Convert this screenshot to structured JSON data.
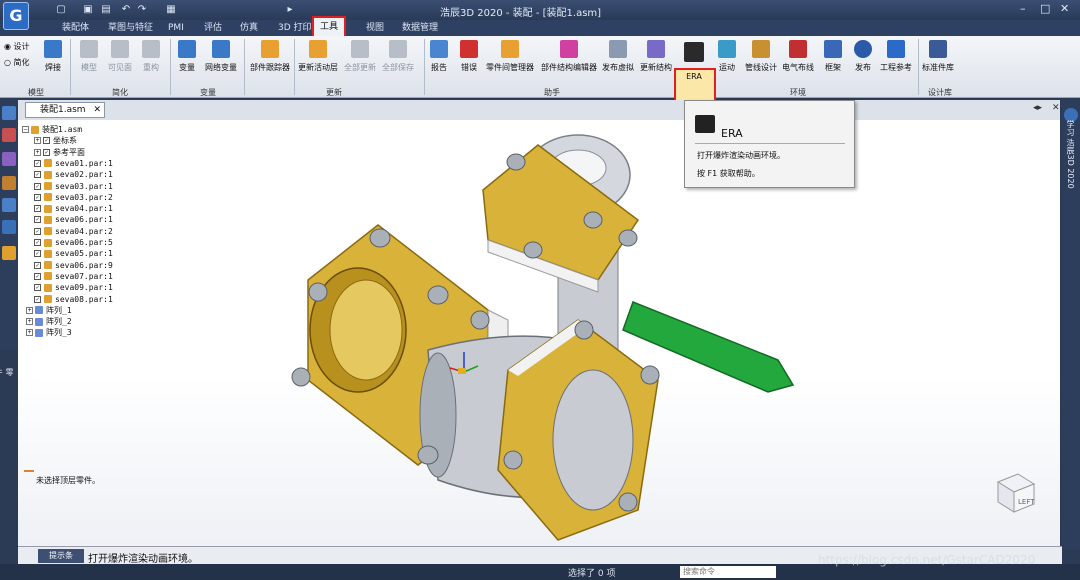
{
  "app": {
    "title": "浩辰3D 2020 - 装配 - [装配1.asm]"
  },
  "quick_access": [
    "new-icon",
    "open-icon",
    "save-icon",
    "undo-icon",
    "redo-icon",
    "print-icon",
    "dropdown-icon"
  ],
  "tabs": [
    "装配体",
    "草图与特征",
    "PMI",
    "评估",
    "仿真",
    "3D 打印",
    "工具",
    "视图",
    "数据管理"
  ],
  "active_tab": "工具",
  "ribbon": {
    "mode_options": [
      "设计",
      "简化"
    ],
    "buttons": [
      {
        "label": "焊接",
        "icon": "weld-icon"
      },
      {
        "label": "模型",
        "icon": "model-icon",
        "disabled": true
      },
      {
        "label": "可见面",
        "icon": "visible-face-icon",
        "disabled": true
      },
      {
        "label": "重构",
        "icon": "rebuild-icon",
        "disabled": true
      },
      {
        "label": "变量",
        "icon": "variable-icon"
      },
      {
        "label": "网络变量",
        "icon": "network-variable-icon"
      },
      {
        "label": "部件跟踪器",
        "icon": "tracker-icon"
      },
      {
        "label": "更新活动层",
        "icon": "update-layer-icon"
      },
      {
        "label": "全部更新",
        "icon": "update-all-icon",
        "disabled": true
      },
      {
        "label": "全部保存",
        "icon": "save-all-icon",
        "disabled": true
      },
      {
        "label": "报告",
        "icon": "report-icon"
      },
      {
        "label": "错误",
        "icon": "error-icon"
      },
      {
        "label": "零件间管理器",
        "icon": "interpart-icon"
      },
      {
        "label": "部件结构编辑器",
        "icon": "structure-editor-icon"
      },
      {
        "label": "发布虚拟",
        "icon": "publish-virtual-icon"
      },
      {
        "label": "更新结构",
        "icon": "update-structure-icon"
      },
      {
        "label": "ERA",
        "icon": "era-icon"
      },
      {
        "label": "运动",
        "icon": "motion-icon"
      },
      {
        "label": "管线设计",
        "icon": "piping-icon"
      },
      {
        "label": "电气布线",
        "icon": "wiring-icon"
      },
      {
        "label": "框架",
        "icon": "frame-icon"
      },
      {
        "label": "发布",
        "icon": "publish-icon"
      },
      {
        "label": "工程参考",
        "icon": "engineering-ref-icon"
      },
      {
        "label": "标准件库",
        "icon": "standard-parts-icon"
      }
    ],
    "groups": [
      "模型",
      "简化",
      "变量",
      "更新",
      "助手",
      "环境",
      "设计库"
    ]
  },
  "tooltip": {
    "title": "ERA",
    "description": "打开爆炸渲染动画环境。",
    "help": "按 F1 获取帮助。"
  },
  "document": {
    "tab": "装配1.asm"
  },
  "left_toolbar_label": "零件库",
  "right_toolbar_label": "学习 浩辰3D 2020",
  "tree": [
    {
      "label": "装配1.asm",
      "level": 0,
      "type": "root"
    },
    {
      "label": "坐标系",
      "level": 1,
      "type": "folder"
    },
    {
      "label": "参考平面",
      "level": 1,
      "type": "folder"
    },
    {
      "label": "seva01.par:1",
      "level": 1,
      "type": "part"
    },
    {
      "label": "seva02.par:1",
      "level": 1,
      "type": "part"
    },
    {
      "label": "seva03.par:1",
      "level": 1,
      "type": "part"
    },
    {
      "label": "seva03.par:2",
      "level": 1,
      "type": "part"
    },
    {
      "label": "seva04.par:1",
      "level": 1,
      "type": "part"
    },
    {
      "label": "seva06.par:1",
      "level": 1,
      "type": "part"
    },
    {
      "label": "seva04.par:2",
      "level": 1,
      "type": "part"
    },
    {
      "label": "seva06.par:5",
      "level": 1,
      "type": "part"
    },
    {
      "label": "seva05.par:1",
      "level": 1,
      "type": "part"
    },
    {
      "label": "seva06.par:9",
      "level": 1,
      "type": "part"
    },
    {
      "label": "seva07.par:1",
      "level": 1,
      "type": "part"
    },
    {
      "label": "seva09.par:1",
      "level": 1,
      "type": "part"
    },
    {
      "label": "seva08.par:1",
      "level": 1,
      "type": "part"
    },
    {
      "label": "阵列_1",
      "level": 0,
      "type": "pattern"
    },
    {
      "label": "阵列_2",
      "level": 0,
      "type": "pattern"
    },
    {
      "label": "阵列_3",
      "level": 0,
      "type": "pattern"
    }
  ],
  "status": {
    "message": "未选择顶层零件。",
    "command_label": "提示条",
    "command_text": "打开爆炸渲染动画环境。",
    "selection": "选择了 0 项",
    "find_placeholder": "搜索命令"
  },
  "viewcube": {
    "face": "LEFT"
  },
  "watermark": "https://blog.csdn.net/GstarCAD2020",
  "colors": {
    "accent": "#e02020",
    "handle": "#1fa83a",
    "brass": "#d9b23a",
    "steel": "#c8ccd2"
  }
}
